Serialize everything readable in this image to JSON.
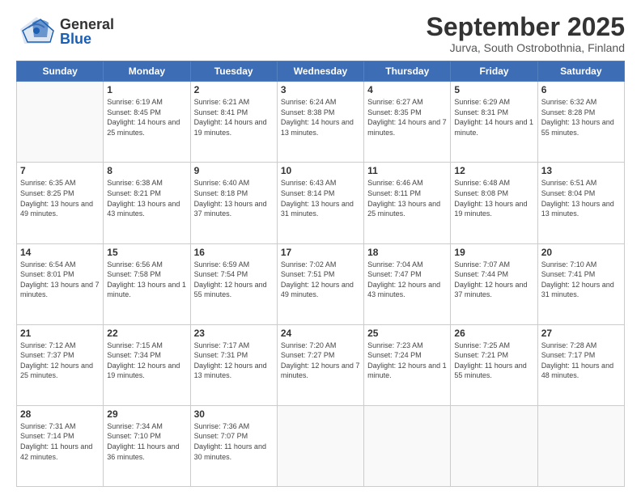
{
  "logo": {
    "general": "General",
    "blue": "Blue"
  },
  "header": {
    "month": "September 2025",
    "location": "Jurva, South Ostrobothnia, Finland"
  },
  "days_header": [
    "Sunday",
    "Monday",
    "Tuesday",
    "Wednesday",
    "Thursday",
    "Friday",
    "Saturday"
  ],
  "weeks": [
    [
      {
        "day": "",
        "info": ""
      },
      {
        "day": "1",
        "info": "Sunrise: 6:19 AM\nSunset: 8:45 PM\nDaylight: 14 hours\nand 25 minutes."
      },
      {
        "day": "2",
        "info": "Sunrise: 6:21 AM\nSunset: 8:41 PM\nDaylight: 14 hours\nand 19 minutes."
      },
      {
        "day": "3",
        "info": "Sunrise: 6:24 AM\nSunset: 8:38 PM\nDaylight: 14 hours\nand 13 minutes."
      },
      {
        "day": "4",
        "info": "Sunrise: 6:27 AM\nSunset: 8:35 PM\nDaylight: 14 hours\nand 7 minutes."
      },
      {
        "day": "5",
        "info": "Sunrise: 6:29 AM\nSunset: 8:31 PM\nDaylight: 14 hours\nand 1 minute."
      },
      {
        "day": "6",
        "info": "Sunrise: 6:32 AM\nSunset: 8:28 PM\nDaylight: 13 hours\nand 55 minutes."
      }
    ],
    [
      {
        "day": "7",
        "info": "Sunrise: 6:35 AM\nSunset: 8:25 PM\nDaylight: 13 hours\nand 49 minutes."
      },
      {
        "day": "8",
        "info": "Sunrise: 6:38 AM\nSunset: 8:21 PM\nDaylight: 13 hours\nand 43 minutes."
      },
      {
        "day": "9",
        "info": "Sunrise: 6:40 AM\nSunset: 8:18 PM\nDaylight: 13 hours\nand 37 minutes."
      },
      {
        "day": "10",
        "info": "Sunrise: 6:43 AM\nSunset: 8:14 PM\nDaylight: 13 hours\nand 31 minutes."
      },
      {
        "day": "11",
        "info": "Sunrise: 6:46 AM\nSunset: 8:11 PM\nDaylight: 13 hours\nand 25 minutes."
      },
      {
        "day": "12",
        "info": "Sunrise: 6:48 AM\nSunset: 8:08 PM\nDaylight: 13 hours\nand 19 minutes."
      },
      {
        "day": "13",
        "info": "Sunrise: 6:51 AM\nSunset: 8:04 PM\nDaylight: 13 hours\nand 13 minutes."
      }
    ],
    [
      {
        "day": "14",
        "info": "Sunrise: 6:54 AM\nSunset: 8:01 PM\nDaylight: 13 hours\nand 7 minutes."
      },
      {
        "day": "15",
        "info": "Sunrise: 6:56 AM\nSunset: 7:58 PM\nDaylight: 13 hours\nand 1 minute."
      },
      {
        "day": "16",
        "info": "Sunrise: 6:59 AM\nSunset: 7:54 PM\nDaylight: 12 hours\nand 55 minutes."
      },
      {
        "day": "17",
        "info": "Sunrise: 7:02 AM\nSunset: 7:51 PM\nDaylight: 12 hours\nand 49 minutes."
      },
      {
        "day": "18",
        "info": "Sunrise: 7:04 AM\nSunset: 7:47 PM\nDaylight: 12 hours\nand 43 minutes."
      },
      {
        "day": "19",
        "info": "Sunrise: 7:07 AM\nSunset: 7:44 PM\nDaylight: 12 hours\nand 37 minutes."
      },
      {
        "day": "20",
        "info": "Sunrise: 7:10 AM\nSunset: 7:41 PM\nDaylight: 12 hours\nand 31 minutes."
      }
    ],
    [
      {
        "day": "21",
        "info": "Sunrise: 7:12 AM\nSunset: 7:37 PM\nDaylight: 12 hours\nand 25 minutes."
      },
      {
        "day": "22",
        "info": "Sunrise: 7:15 AM\nSunset: 7:34 PM\nDaylight: 12 hours\nand 19 minutes."
      },
      {
        "day": "23",
        "info": "Sunrise: 7:17 AM\nSunset: 7:31 PM\nDaylight: 12 hours\nand 13 minutes."
      },
      {
        "day": "24",
        "info": "Sunrise: 7:20 AM\nSunset: 7:27 PM\nDaylight: 12 hours\nand 7 minutes."
      },
      {
        "day": "25",
        "info": "Sunrise: 7:23 AM\nSunset: 7:24 PM\nDaylight: 12 hours\nand 1 minute."
      },
      {
        "day": "26",
        "info": "Sunrise: 7:25 AM\nSunset: 7:21 PM\nDaylight: 11 hours\nand 55 minutes."
      },
      {
        "day": "27",
        "info": "Sunrise: 7:28 AM\nSunset: 7:17 PM\nDaylight: 11 hours\nand 48 minutes."
      }
    ],
    [
      {
        "day": "28",
        "info": "Sunrise: 7:31 AM\nSunset: 7:14 PM\nDaylight: 11 hours\nand 42 minutes."
      },
      {
        "day": "29",
        "info": "Sunrise: 7:34 AM\nSunset: 7:10 PM\nDaylight: 11 hours\nand 36 minutes."
      },
      {
        "day": "30",
        "info": "Sunrise: 7:36 AM\nSunset: 7:07 PM\nDaylight: 11 hours\nand 30 minutes."
      },
      {
        "day": "",
        "info": ""
      },
      {
        "day": "",
        "info": ""
      },
      {
        "day": "",
        "info": ""
      },
      {
        "day": "",
        "info": ""
      }
    ]
  ]
}
